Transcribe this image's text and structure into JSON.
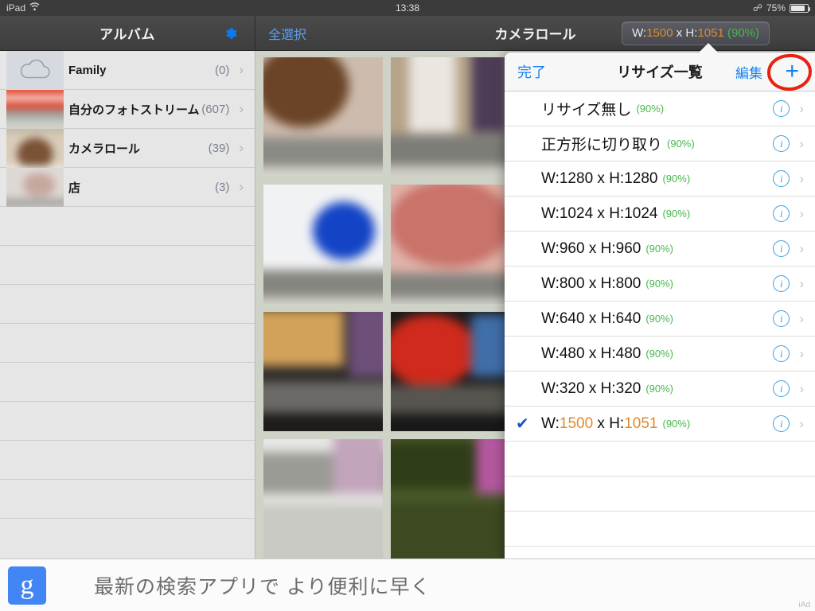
{
  "status_bar": {
    "device": "iPad",
    "wifi_icon": "wifi-icon",
    "time": "13:38",
    "bluetooth_icon": "bluetooth-icon",
    "battery_percent": "75%",
    "battery_icon": "battery-icon"
  },
  "sidebar": {
    "title": "アルバム",
    "settings_icon": "gear-icon",
    "albums": [
      {
        "name": "Family",
        "count": "(0)",
        "thumb": "cloud"
      },
      {
        "name": "自分のフォトストリーム",
        "count": "(607)",
        "thumb": "photo-red"
      },
      {
        "name": "カメラロール",
        "count": "(39)",
        "thumb": "photo-brown"
      },
      {
        "name": "店",
        "count": "(3)",
        "thumb": "photo-light"
      }
    ],
    "chevron_icon": "chevron-right-icon"
  },
  "main": {
    "select_all_label": "全選択",
    "title": "カメラロール",
    "resize_button": {
      "prefix": "W:",
      "width": "1500",
      "middle": " x H:",
      "height": "1051",
      "percent": " (90%)"
    },
    "photo_count": "39"
  },
  "popover": {
    "done_label": "完了",
    "title": "リサイズ一覧",
    "edit_label": "編集",
    "add_icon": "plus-icon",
    "annotation": "red-circle-highlight",
    "info_icon": "info-icon",
    "chevron_icon": "chevron-right-icon",
    "check_icon": "checkmark-icon",
    "rows": [
      {
        "label": "リサイズ無し",
        "percent": "(90%)",
        "selected": false,
        "highlight": false
      },
      {
        "label": "正方形に切り取り",
        "percent": "(90%)",
        "selected": false,
        "highlight": false
      },
      {
        "label": "W:1280 x H:1280",
        "percent": "(90%)",
        "selected": false,
        "highlight": false
      },
      {
        "label": "W:1024 x H:1024",
        "percent": "(90%)",
        "selected": false,
        "highlight": false
      },
      {
        "label": "W:960 x H:960",
        "percent": "(90%)",
        "selected": false,
        "highlight": false
      },
      {
        "label": "W:800 x H:800",
        "percent": "(90%)",
        "selected": false,
        "highlight": false
      },
      {
        "label": "W:640 x H:640",
        "percent": "(90%)",
        "selected": false,
        "highlight": false
      },
      {
        "label": "W:480 x H:480",
        "percent": "(90%)",
        "selected": false,
        "highlight": false
      },
      {
        "label": "W:320 x H:320",
        "percent": "(90%)",
        "selected": false,
        "highlight": false
      },
      {
        "label": "W:1500 x H:1051",
        "percent": "(90%)",
        "selected": true,
        "highlight": true,
        "prefix": "W:",
        "width": "1500",
        "middle": " x H:",
        "height": "1051"
      }
    ],
    "empty_row_count": 4
  },
  "ad_banner": {
    "logo": "google-g-logo",
    "text": "最新の検索アプリで より便利に早く",
    "label": "iAd"
  },
  "colors": {
    "accent_blue": "#1383f0",
    "orange": "#e08a2e",
    "green": "#46b84b",
    "annotation_red": "#e8220f",
    "check_blue": "#1956c8"
  }
}
